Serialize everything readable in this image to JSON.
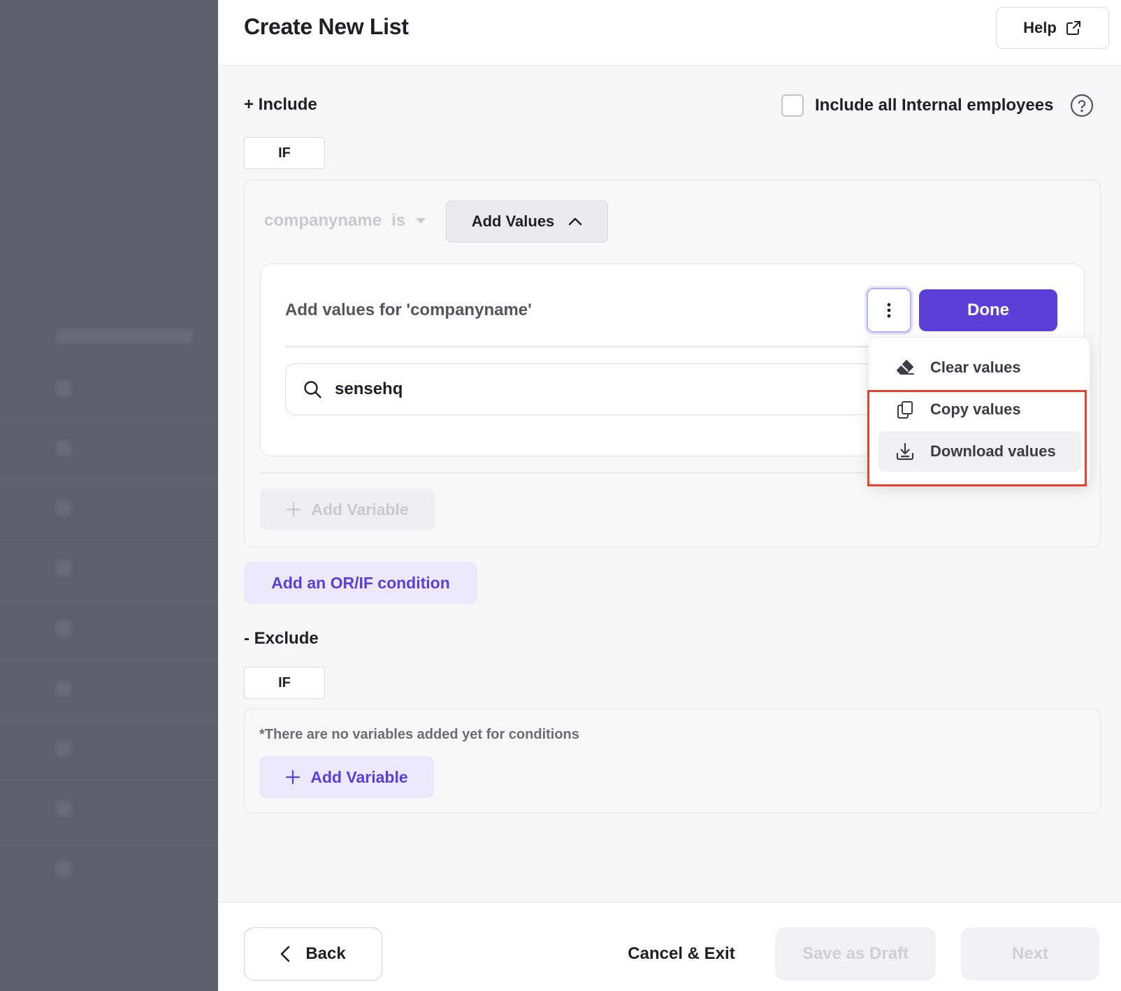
{
  "header": {
    "title": "Create New List",
    "help_label": "Help"
  },
  "include": {
    "label": "+ Include",
    "if_label": "IF",
    "internal_employees_label": "Include all Internal employees",
    "internal_employees_checked": false,
    "condition": {
      "variable": "companyname",
      "operator": "is",
      "add_values_label": "Add Values"
    },
    "values_panel": {
      "title": "Add values for 'companyname'",
      "done_label": "Done",
      "search_value": "sensehq"
    },
    "add_variable_label": "Add Variable",
    "add_condition_label": "Add an OR/IF condition"
  },
  "menu": {
    "items": [
      {
        "label": "Clear values",
        "icon": "eraser-icon"
      },
      {
        "label": "Copy values",
        "icon": "copy-icon"
      },
      {
        "label": "Download values",
        "icon": "download-icon"
      }
    ]
  },
  "exclude": {
    "label": "- Exclude",
    "if_label": "IF",
    "empty_note": "*There are no variables added yet for conditions",
    "add_variable_label": "Add Variable"
  },
  "footer": {
    "back_label": "Back",
    "cancel_label": "Cancel & Exit",
    "draft_label": "Save as Draft",
    "next_label": "Next"
  },
  "colors": {
    "accent": "#5b3fd6",
    "accent_soft": "#ebe9fb",
    "highlight": "#e5432d",
    "backdrop": "#5f5f6b"
  }
}
